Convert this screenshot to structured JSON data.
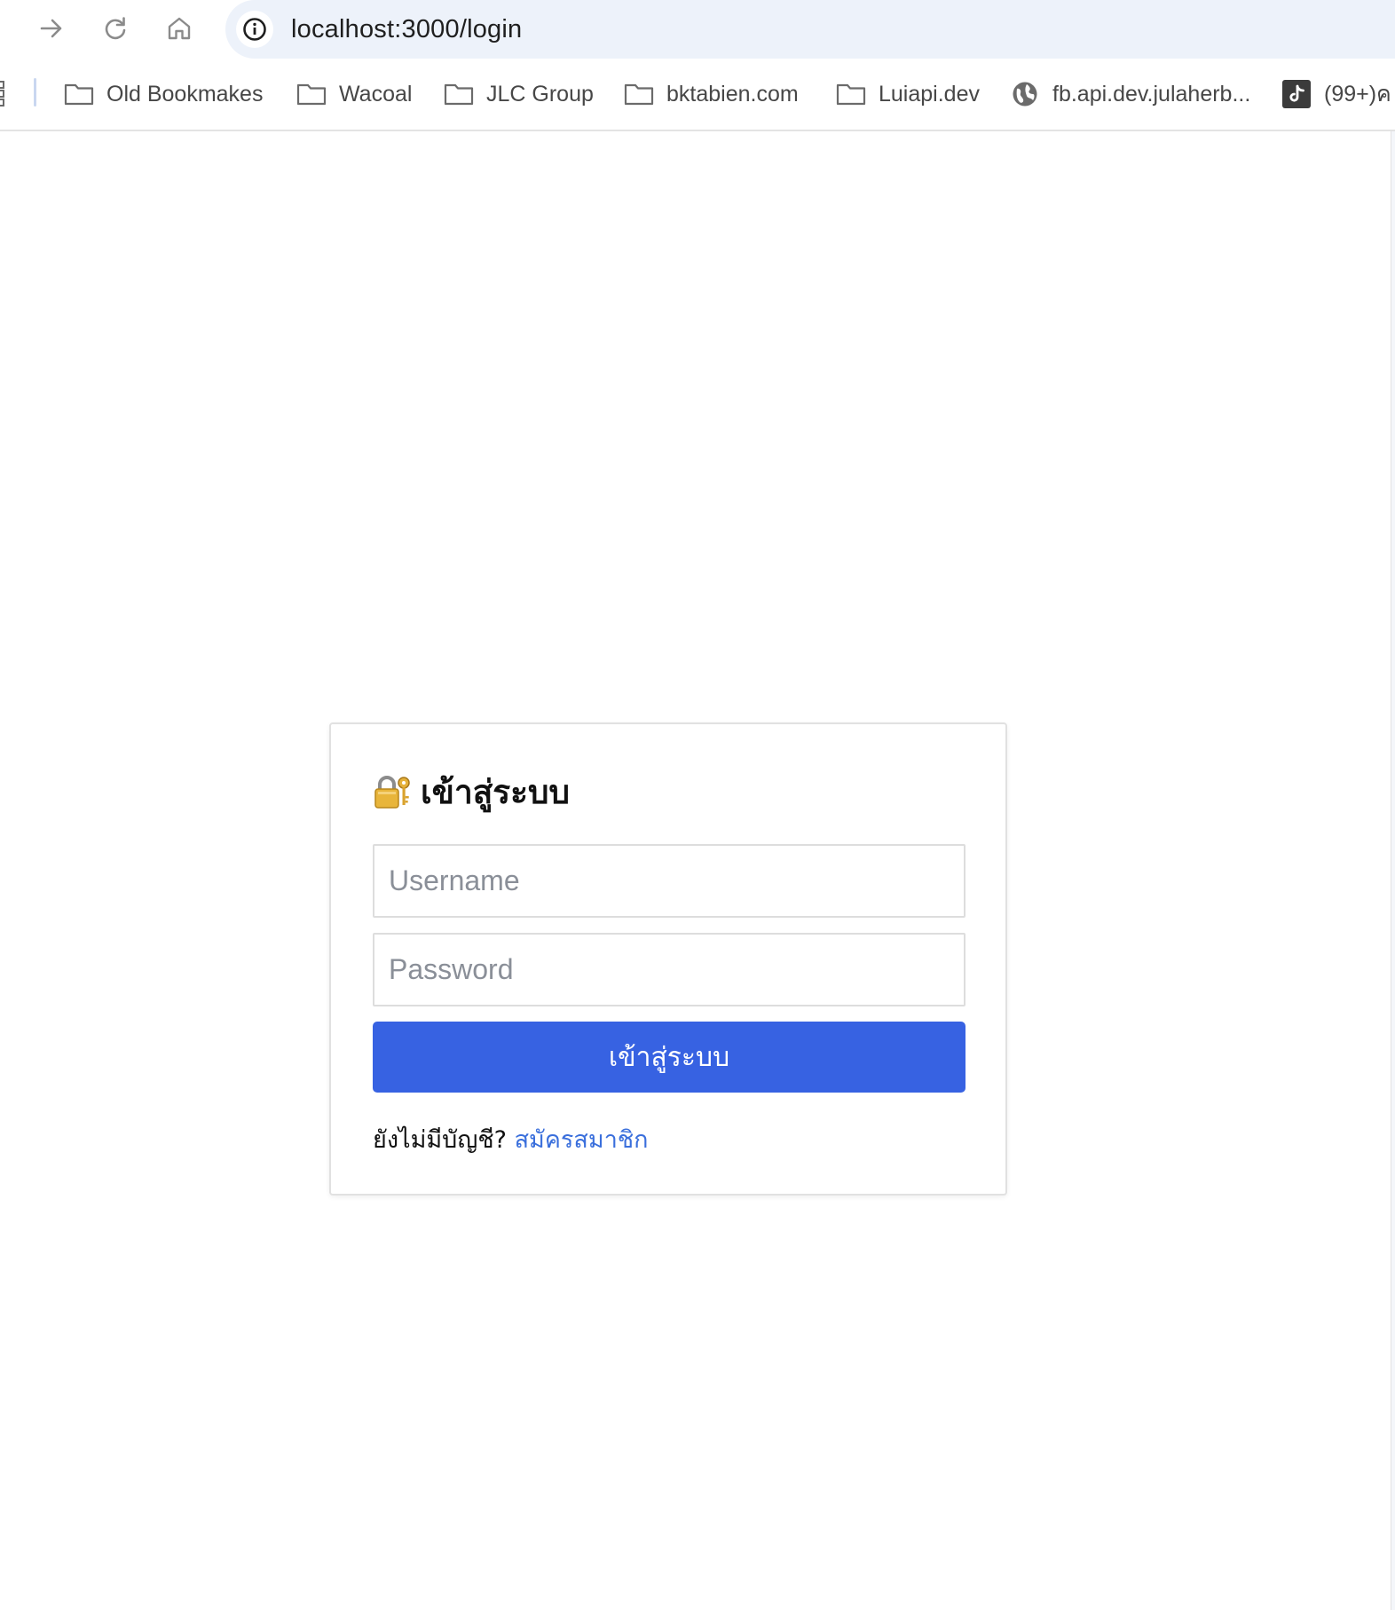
{
  "browser": {
    "url": "localhost:3000/login",
    "nav": {
      "forward": "arrow-right-icon",
      "reload": "reload-icon",
      "home": "home-icon",
      "site_info": "info-icon"
    },
    "bookmarks": [
      {
        "label": "Old Bookmakes",
        "icon": "folder-icon"
      },
      {
        "label": "Wacoal",
        "icon": "folder-icon"
      },
      {
        "label": "JLC Group",
        "icon": "folder-icon"
      },
      {
        "label": "bktabien.com",
        "icon": "folder-icon"
      },
      {
        "label": "Luiapi.dev",
        "icon": "folder-icon"
      },
      {
        "label": "fb.api.dev.julaherb...",
        "icon": "globe-icon"
      },
      {
        "label": "(99+)ค",
        "icon": "tiktok-icon"
      }
    ]
  },
  "login": {
    "title": "เข้าสู่ระบบ",
    "title_icon": "locked-with-key-icon",
    "username_placeholder": "Username",
    "password_placeholder": "Password",
    "submit_label": "เข้าสู่ระบบ",
    "signup_prompt": "ยังไม่มีบัญชี?",
    "signup_link": "สมัครสมาชิก"
  },
  "colors": {
    "primary_button": "#3762e2",
    "link": "#3a6fdc",
    "omnibox_bg": "#edf2fa"
  }
}
